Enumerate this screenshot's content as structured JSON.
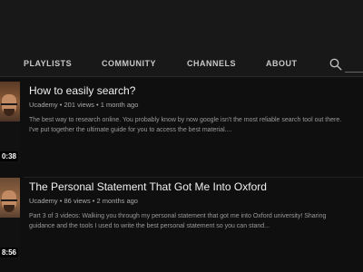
{
  "tabs": [
    "PLAYLISTS",
    "COMMUNITY",
    "CHANNELS",
    "ABOUT"
  ],
  "search_icon": "search-icon",
  "videos": [
    {
      "title": "How to easily search?",
      "channel": "Ucademy",
      "views": "201 views",
      "separator": "•",
      "age": "1 month ago",
      "description": [
        "The best way to research online. You probably know by now google isn't the most reliable search tool out there.",
        "I've put together the ultimate guide for you to access the best material...."
      ],
      "duration": "0:38"
    },
    {
      "title": "The Personal Statement That Got Me Into Oxford",
      "channel": "Ucademy",
      "views": "86 views",
      "separator": "•",
      "age": "2 months ago",
      "description": [
        "Part 3 of 3 videos: Walking you through my personal statement that got me into Oxford university! Sharing",
        "guidance and the tools I used to write the best personal statement so you can stand..."
      ],
      "duration": "8:56"
    }
  ]
}
